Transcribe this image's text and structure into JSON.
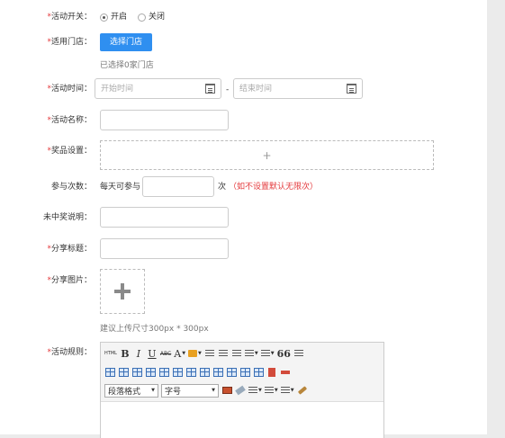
{
  "form": {
    "activity_switch": {
      "label": "活动开关：",
      "options": [
        {
          "label": "开启",
          "selected": true
        },
        {
          "label": "关闭",
          "selected": false
        }
      ]
    },
    "stores": {
      "label": "适用门店：",
      "button": "选择门店",
      "hint": "已选择0家门店"
    },
    "activity_time": {
      "label": "活动时间：",
      "start_placeholder": "开始时间",
      "separator": "-",
      "end_placeholder": "结束时间"
    },
    "activity_name": {
      "label": "活动名称：",
      "value": ""
    },
    "prize_settings": {
      "label": "奖品设置：",
      "add_symbol": "+"
    },
    "participation": {
      "label": "参与次数：",
      "prefix": "每天可参与",
      "value": "",
      "suffix": "次",
      "note": "（如不设置默认无限次）"
    },
    "no_win_desc": {
      "label": "未中奖说明：",
      "value": ""
    },
    "share_title": {
      "label": "分享标题：",
      "value": ""
    },
    "share_image": {
      "label": "分享图片：",
      "hint": "建议上传尺寸300px * 300px"
    },
    "rules": {
      "label": "活动规则：",
      "toolbar": {
        "html": "HTML",
        "bold": "B",
        "italic": "I",
        "underline": "U",
        "strike": "ABC",
        "font_color": "A",
        "quote": "66",
        "paragraph_select": "段落格式",
        "font_size_select": "字号"
      }
    }
  },
  "required_mark": "*",
  "colors": {
    "primary": "#2f8ff0",
    "required": "#e4393c",
    "border": "#cccccc"
  }
}
